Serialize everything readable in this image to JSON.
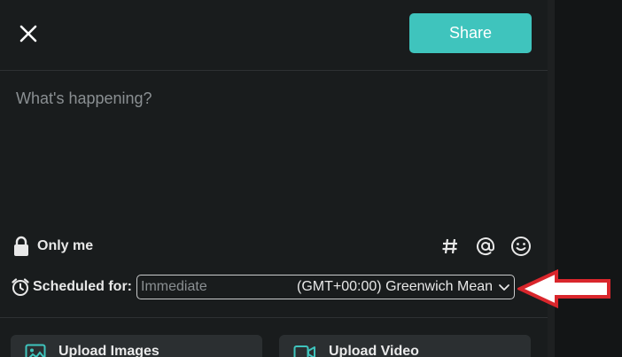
{
  "header": {
    "share_label": "Share"
  },
  "composer": {
    "placeholder": "What's happening?"
  },
  "privacy": {
    "label": "Only me"
  },
  "schedule": {
    "label": "Scheduled for:",
    "placeholder": "Immediate",
    "timezone": "(GMT+00:00) Greenwich Mean"
  },
  "uploads": {
    "images_label": "Upload Images",
    "video_label": "Upload Video"
  },
  "icons": {
    "close": "close-icon",
    "lock": "lock-icon",
    "hashtag": "hashtag-icon",
    "mention": "at-mention-icon",
    "emoji": "emoji-icon",
    "alarm": "alarm-clock-icon",
    "chevron": "chevron-down-icon",
    "image": "image-icon",
    "video": "video-icon",
    "callout": "red-arrow-left-icon"
  },
  "colors": {
    "accent": "#3fc4bd",
    "modal_bg": "#191c1d",
    "callout": "#d9262c"
  }
}
